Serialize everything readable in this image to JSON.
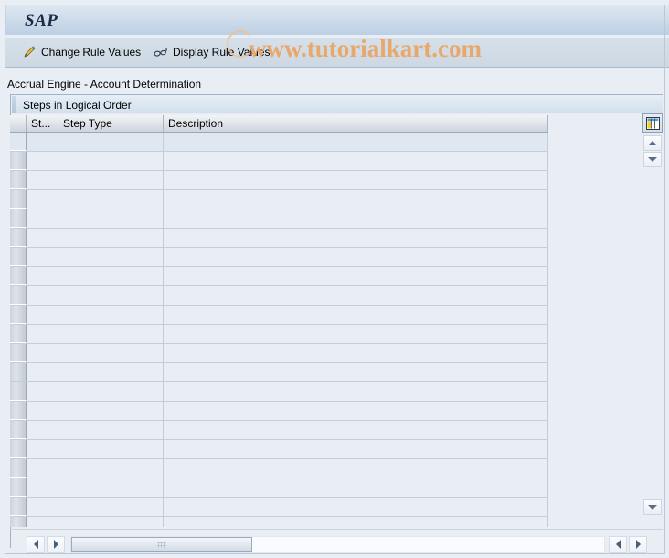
{
  "window": {
    "logo": "SAP",
    "screen_caption": "Accrual Engine - Account Determination",
    "watermark": "www.tutorialkart.com"
  },
  "toolbar": {
    "buttons": [
      {
        "label": "Change Rule Values",
        "icon": "pencil-icon"
      },
      {
        "label": "Display Rule Values",
        "icon": "glasses-icon"
      }
    ]
  },
  "panel": {
    "title": "Steps in Logical Order"
  },
  "grid": {
    "columns": [
      {
        "key": "select",
        "label": ""
      },
      {
        "key": "st",
        "label": "St..."
      },
      {
        "key": "step_type",
        "label": "Step Type"
      },
      {
        "key": "description",
        "label": "Description"
      }
    ],
    "rows": [],
    "row_count": 21,
    "settings_icon": "table-settings-icon"
  },
  "scrollbars": {
    "vertical": {
      "up_icon": "triangle-up-icon",
      "down_icon": "triangle-down-icon",
      "bottom_down_icon": "triangle-down-icon"
    },
    "horizontal": {
      "left_icon": "triangle-left-icon",
      "right_icon": "triangle-right-icon",
      "thumb_grip": "grip-dots"
    }
  },
  "colors": {
    "title_bar": "#cfdcea",
    "toolbar": "#d2dce6",
    "content_bg": "#e9eef5",
    "grid_row_bg": "#e9eef5",
    "grid_row_selected_bg": "#dfe8f1",
    "grid_line": "#c3ced9",
    "watermark": "#e8a86b",
    "text": "#000000"
  }
}
